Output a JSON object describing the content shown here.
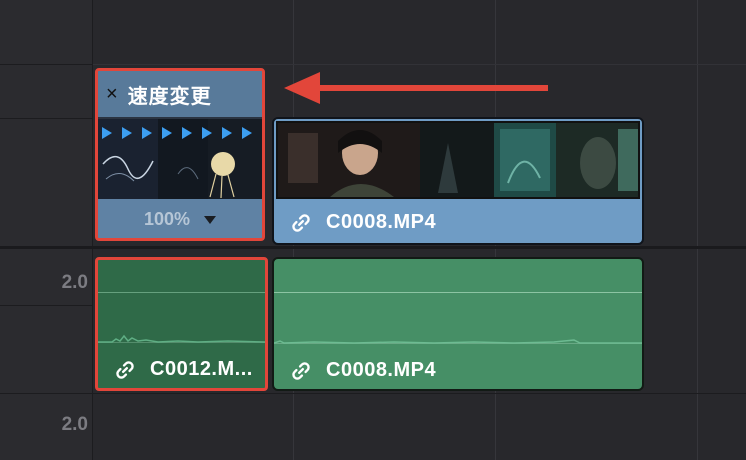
{
  "speed_clip": {
    "title": "速度変更",
    "close_glyph": "×",
    "speed_percent": "100%"
  },
  "video_clip": {
    "name": "C0008.MP4"
  },
  "audio_tracks": {
    "level_1": "2.0",
    "level_2": "2.0"
  },
  "audio_clip_1": {
    "name": "C0012.M..."
  },
  "audio_clip_2": {
    "name": "C0008.MP4"
  },
  "colors": {
    "highlight_red": "#e2463a",
    "video_clip": "#6f9cc5",
    "audio_clip": "#468f66",
    "speed_arrow": "#3c9ef0"
  },
  "icons": [
    "close-icon",
    "link-icon",
    "dropdown-triangle-icon",
    "speed-forward-icon",
    "annotation-arrow-icon"
  ]
}
